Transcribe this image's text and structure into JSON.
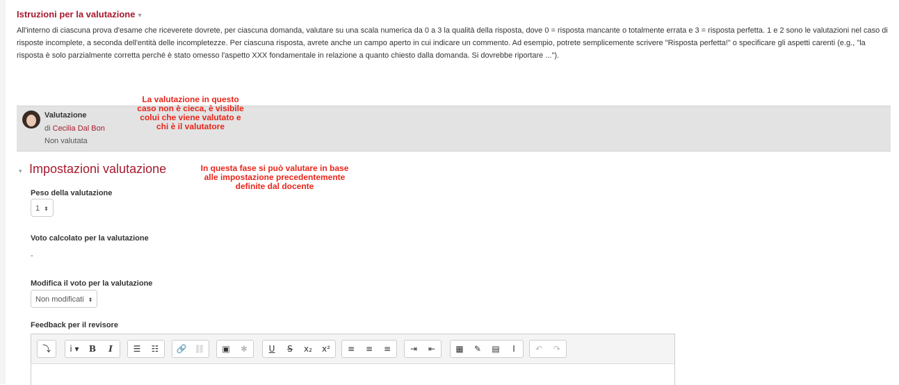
{
  "instructions": {
    "title": "Istruzioni per la valutazione",
    "caret": "▾",
    "para1": "All'interno di ciascuna prova d'esame che riceverete dovrete, per ciascuna domanda, valutare su una scala numerica da 0 a 3 la qualità della risposta, dove 0 = risposta mancante o totalmente errata e 3  = risposta perfetta. 1 e 2 sono le valutazioni nel caso di risposte incomplete, a seconda dell'entità delle incompletezze. Per ciascuna risposta, avrete anche un campo aperto in cui indicare un commento. Ad esempio, potrete semplicemente scrivere \"Risposta perfetta!\" o specificare gli aspetti carenti (e.g., \"la risposta è solo parzialmente corretta perché è stato omesso l'aspetto XXX fondamentale in relazione a quanto chiesto dalla domanda. Si dovrebbe riportare ...\")."
  },
  "grading": {
    "title": "Valutazione",
    "by_prefix": "di",
    "author": "Cecilia Dal Bon",
    "status": "Non valutata"
  },
  "annotations": {
    "note1": "La valutazione in questo\ncaso non è cieca, è visibile\ncolui che viene valutato e\nchi è il valutatore",
    "note2": "In questa fase si può valutare in base\nalle impostazione precedentemente\ndefinite dal docente"
  },
  "settings": {
    "caret": "▾",
    "title": "Impostazioni valutazione",
    "weight_label": "Peso della valutazione",
    "weight_value": "1",
    "calc_label": "Voto calcolato per la valutazione",
    "calc_value": "-",
    "override_label": "Modifica il voto per la valutazione",
    "override_value": "Non modificati",
    "feedback_label": "Feedback per il revisore"
  },
  "editor": {
    "groups": [
      [
        "⤵"
      ],
      [
        "i ▾",
        "B",
        "I"
      ],
      [
        "☰",
        "☷"
      ],
      [
        "🔗",
        "⛓"
      ],
      [
        "▣",
        "✱"
      ],
      [
        "U",
        "S",
        "x₂",
        "x²"
      ],
      [
        "≡",
        "≡",
        "≡"
      ],
      [
        "⇥",
        "⇤"
      ],
      [
        "▦",
        "✎",
        "▤",
        "I"
      ],
      [
        "↶",
        "↷"
      ]
    ]
  }
}
